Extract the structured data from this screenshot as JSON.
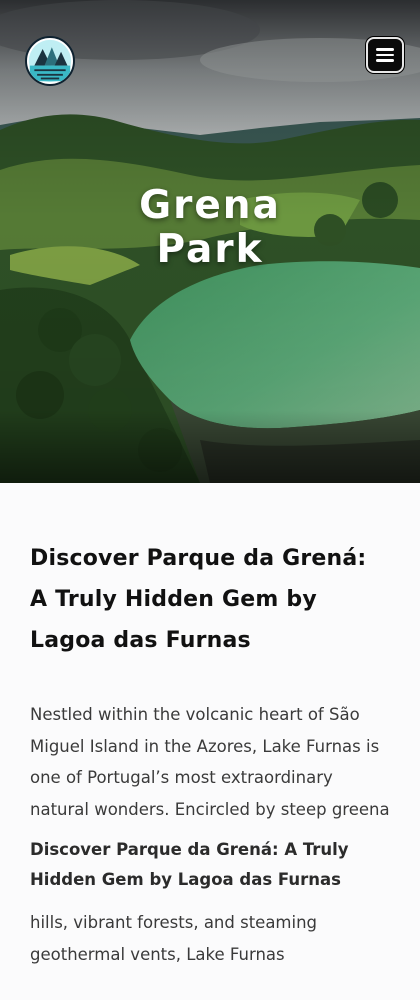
{
  "header": {
    "logo_icon": "mountain-lake-logo-icon",
    "menu_icon": "hamburger-menu-icon"
  },
  "hero": {
    "title_line1": "Grena",
    "title_line2": "Park",
    "image": "aerial-lake-landscape"
  },
  "article": {
    "heading": "Discover Parque da Grená: A Truly Hidden Gem by Lagoa das Furnas",
    "paragraph1": "Nestled within the volcanic heart of São Miguel Island in the Azores, Lake Furnas is one of Portugal’s most extraordinary natural wonders. Encircled by steep greena",
    "subheading": "Discover Parque da Grená: A Truly Hidden Gem by Lagoa das Furnas",
    "paragraph2": "hills, vibrant forests, and steaming geothermal vents, Lake Furnas"
  },
  "colors": {
    "page_bg": "#fbfbfc",
    "menu_button": "#0a0a0a",
    "logo_teal": "#3ab8c6"
  }
}
